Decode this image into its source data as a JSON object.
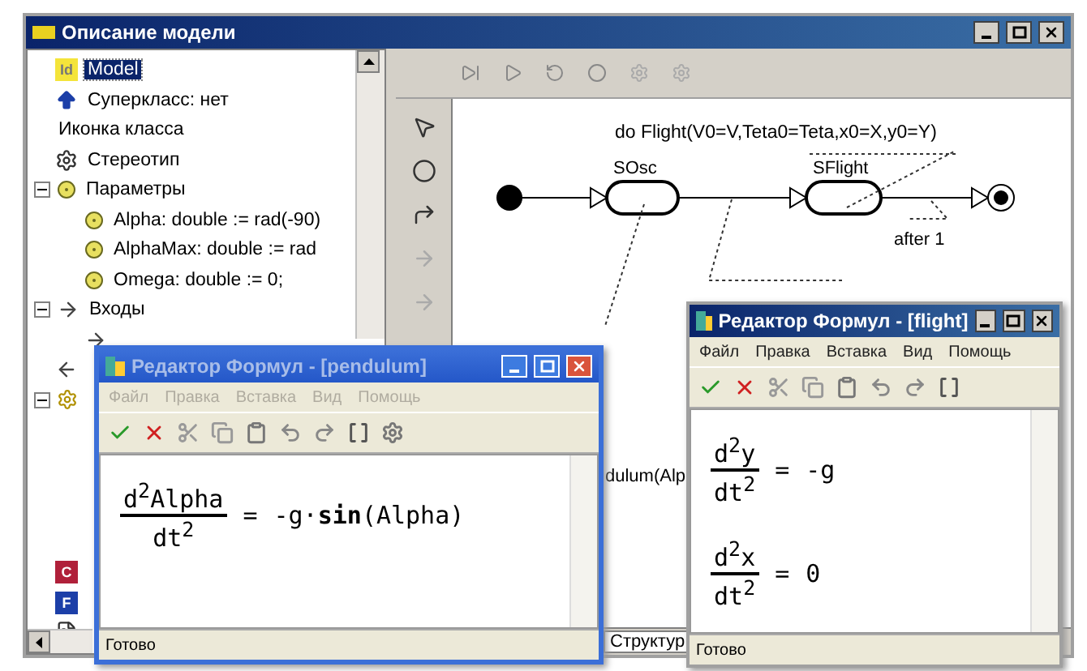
{
  "main_window": {
    "title": "Описание модели"
  },
  "tree": [
    {
      "kind": "id",
      "badge": "Id",
      "label": "Model",
      "selected": true
    },
    {
      "kind": "superclass",
      "label": "Суперкласс: нет",
      "selected": false
    },
    {
      "kind": "blank",
      "label": "Иконка класса",
      "selected": false
    },
    {
      "kind": "stereotype",
      "label": "Стереотип",
      "selected": false
    },
    {
      "kind": "param",
      "label": "Параметры",
      "selected": false,
      "expanded": true,
      "children": [
        {
          "kind": "param",
          "label": "Alpha: double := rad(-90)",
          "selected": false
        },
        {
          "kind": "param",
          "label": "AlphaMax: double := rad",
          "selected": false
        },
        {
          "kind": "param",
          "label": "Omega: double := 0;",
          "selected": false
        }
      ]
    },
    {
      "kind": "input",
      "label": "Входы",
      "selected": false,
      "expanded": true,
      "children": [
        {
          "kind": "input"
        }
      ]
    },
    {
      "kind": "output"
    },
    {
      "kind": "state",
      "expanded": true
    },
    {
      "kind": "class",
      "badge": "C"
    },
    {
      "kind": "function",
      "badge": "F"
    },
    {
      "kind": "document"
    }
  ],
  "diagram": {
    "action": "do Flight(V0=V,Teta0=Teta,x0=X,y0=Y)",
    "states": [
      {
        "label": "SOsc"
      },
      {
        "label": "SFlight"
      }
    ],
    "guard": "after 1",
    "note": "dulum(Alp"
  },
  "bottom_tab": "Структур",
  "editors": [
    {
      "kind": "xp",
      "title": "Редактор Формул - [pendulum]",
      "menu": [
        {
          "label": "Файл",
          "disabled": true
        },
        {
          "label": "Правка",
          "disabled": true
        },
        {
          "label": "Вставка",
          "disabled": true
        },
        {
          "label": "Вид",
          "disabled": true
        },
        {
          "label": "Помощь",
          "disabled": true
        }
      ],
      "formulas": [
        {
          "num": "d$^{2}$Alpha",
          "den": "dt$^{2}$",
          "eq": "=",
          "rhs": "-g·**sin**(Alpha)"
        }
      ],
      "status": "Готово"
    },
    {
      "kind": "classic",
      "title": "Редактор Формул - [flight]",
      "menu": [
        {
          "label": "Файл",
          "disabled": false
        },
        {
          "label": "Правка",
          "disabled": false
        },
        {
          "label": "Вставка",
          "disabled": false
        },
        {
          "label": "Вид",
          "disabled": false
        },
        {
          "label": "Помощь",
          "disabled": false
        }
      ],
      "formulas": [
        {
          "num": "d$^{2}$y",
          "den": "dt$^{2}$",
          "eq": "=",
          "rhs": "-g"
        },
        {
          "num": "d$^{2}$x",
          "den": "dt$^{2}$",
          "eq": "=",
          "rhs": "0"
        }
      ],
      "status": "Готово"
    }
  ]
}
